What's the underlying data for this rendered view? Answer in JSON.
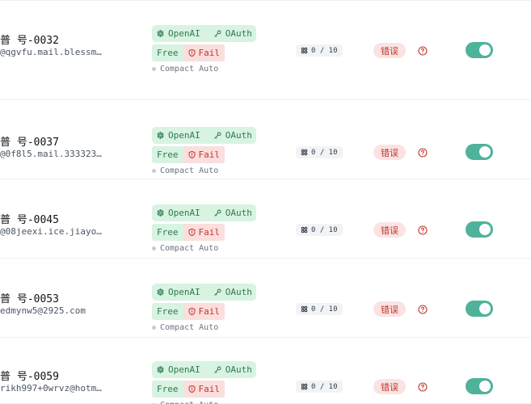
{
  "accounts": [
    {
      "name": "普 号-0032",
      "email": "@qgvfu.mail.blessm…",
      "provider": "OpenAI",
      "auth": "OAuth",
      "plan": "Free",
      "check": "Fail",
      "mode": "Compact Auto",
      "quota": "0 / 10",
      "status": "错误",
      "enabled": true
    },
    {
      "name": "普 号-0037",
      "email": "@0f8l5.mail.333323…",
      "provider": "OpenAI",
      "auth": "OAuth",
      "plan": "Free",
      "check": "Fail",
      "mode": "Compact Auto",
      "quota": "0 / 10",
      "status": "错误",
      "enabled": true
    },
    {
      "name": "普 号-0045",
      "email": "@08jeexi.ice.jiayo…",
      "provider": "OpenAI",
      "auth": "OAuth",
      "plan": "Free",
      "check": "Fail",
      "mode": "Compact Auto",
      "quota": "0 / 10",
      "status": "错误",
      "enabled": true
    },
    {
      "name": "普 号-0053",
      "email": "edmynw5@2925.com",
      "provider": "OpenAI",
      "auth": "OAuth",
      "plan": "Free",
      "check": "Fail",
      "mode": "Compact Auto",
      "quota": "0 / 10",
      "status": "错误",
      "enabled": true
    },
    {
      "name": "普 号-0059",
      "email": "rikh997+0wrvz@hotm…",
      "provider": "OpenAI",
      "auth": "OAuth",
      "plan": "Free",
      "check": "Fail",
      "mode": "Compact Auto",
      "quota": "0 / 10",
      "status": "错误",
      "enabled": true
    }
  ],
  "colors": {
    "accent_green": "#4fb29a",
    "pill_green_bg": "#d8f3e2",
    "pill_green_text": "#2f7a4f",
    "error_bg": "#fbe3e3",
    "error_text": "#c0392b"
  },
  "icons": {
    "provider": "openai-logo-icon",
    "auth": "key-icon",
    "check": "shield-alert-icon",
    "quota": "grid-icon",
    "help": "question-circle-icon"
  }
}
